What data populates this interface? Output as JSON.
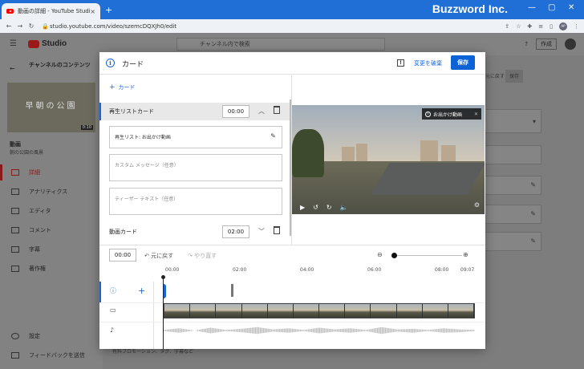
{
  "browser": {
    "tab_title": "動画の詳細 - YouTube Studio",
    "tab_close": "×",
    "new_tab": "+",
    "url": "studio.youtube.com/video/szemcDQXJh0/edit",
    "watermark": "Buzzword Inc.",
    "minimize": "—",
    "maximize": "▢",
    "close": "✕",
    "profile": "AP"
  },
  "studio": {
    "logo": "Studio",
    "search_placeholder": "チャンネル内で検索",
    "create_label": "作成",
    "channel_title": "チャンネルのコンテンツ",
    "thumb_text": "早朝の公園",
    "thumb_duration": "0:10",
    "video_label": "動画",
    "video_sub": "朝の公園の風景",
    "sidebar": [
      {
        "label": "詳細",
        "active": true
      },
      {
        "label": "アナリティクス"
      },
      {
        "label": "エディタ"
      },
      {
        "label": "コメント"
      },
      {
        "label": "字幕"
      },
      {
        "label": "著作権"
      }
    ],
    "settings_label": "設定",
    "feedback_label": "フィードバックを送信",
    "bg_undo": "元に戻す",
    "bg_save": "保存",
    "bg_bottom_text": "有料プロモーション、タグ、字幕など"
  },
  "modal": {
    "title": "カード",
    "discard_label": "変更を破棄",
    "save_label": "保存",
    "add_card_label": "カード",
    "playlist_card": {
      "title": "再生リストカード",
      "time": "00:00",
      "selected_playlist": "再生リスト: お出かけ動画",
      "custom_message_placeholder": "カスタム メッセージ（任意）",
      "teaser_placeholder": "ティーザー テキスト（任意）"
    },
    "video_card": {
      "title": "動画カード",
      "time": "02:00"
    },
    "preview_teaser": "お出かけ動画",
    "timeline": {
      "current_time": "00:00",
      "undo_label": "元に戻す",
      "redo_label": "やり直す",
      "zoom_level": 0.0,
      "ticks": [
        "00:00",
        "02:00",
        "04:00",
        "06:00",
        "08:00",
        "09:07"
      ]
    }
  }
}
